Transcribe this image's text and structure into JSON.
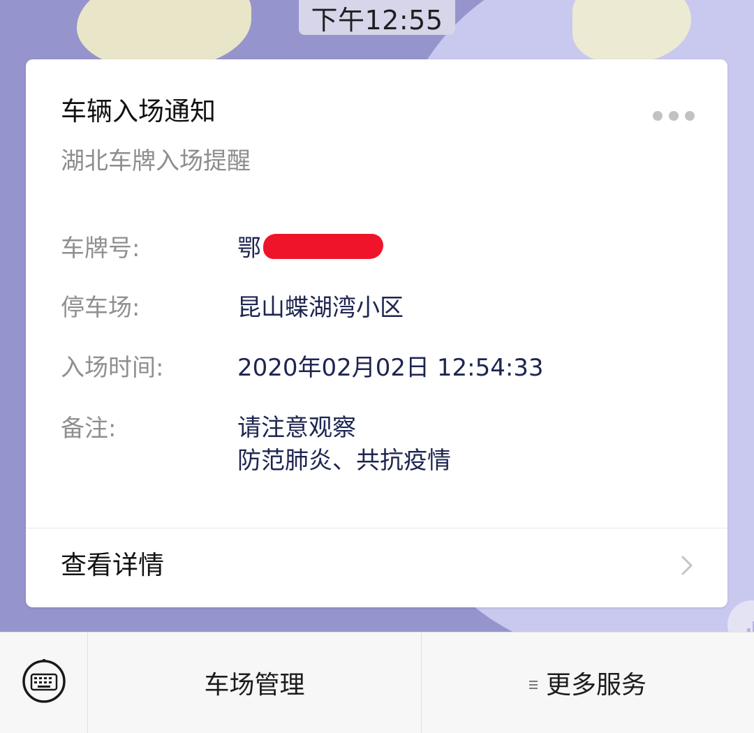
{
  "chat": {
    "timestamp": "下午12:55"
  },
  "card": {
    "title": "车辆入场通知",
    "subtitle": "湖北车牌入场提醒",
    "more_icon": "more-dots-icon",
    "fields": {
      "plate": {
        "label": "车牌号:",
        "value": "鄂"
      },
      "parking_lot": {
        "label": "停车场:",
        "value": "昆山蝶湖湾小区"
      },
      "entry_time": {
        "label": "入场时间:",
        "value": "2020年02月02日 12:54:33"
      },
      "remark": {
        "label": "备注:",
        "lines": [
          "请注意观察",
          "防范肺炎、共抗疫情"
        ]
      }
    },
    "details": {
      "label": "查看详情",
      "icon": "chevron-right-icon"
    },
    "colors": {
      "redaction": "#f0142a",
      "value_text": "#1d2550",
      "label_text": "#8f8f8f"
    }
  },
  "menu": {
    "keyboard_icon": "keyboard-icon",
    "items": [
      {
        "label": "车场管理",
        "has_submenu": false
      },
      {
        "label": "更多服务",
        "has_submenu": true,
        "icon": "submenu-list-icon"
      }
    ]
  }
}
